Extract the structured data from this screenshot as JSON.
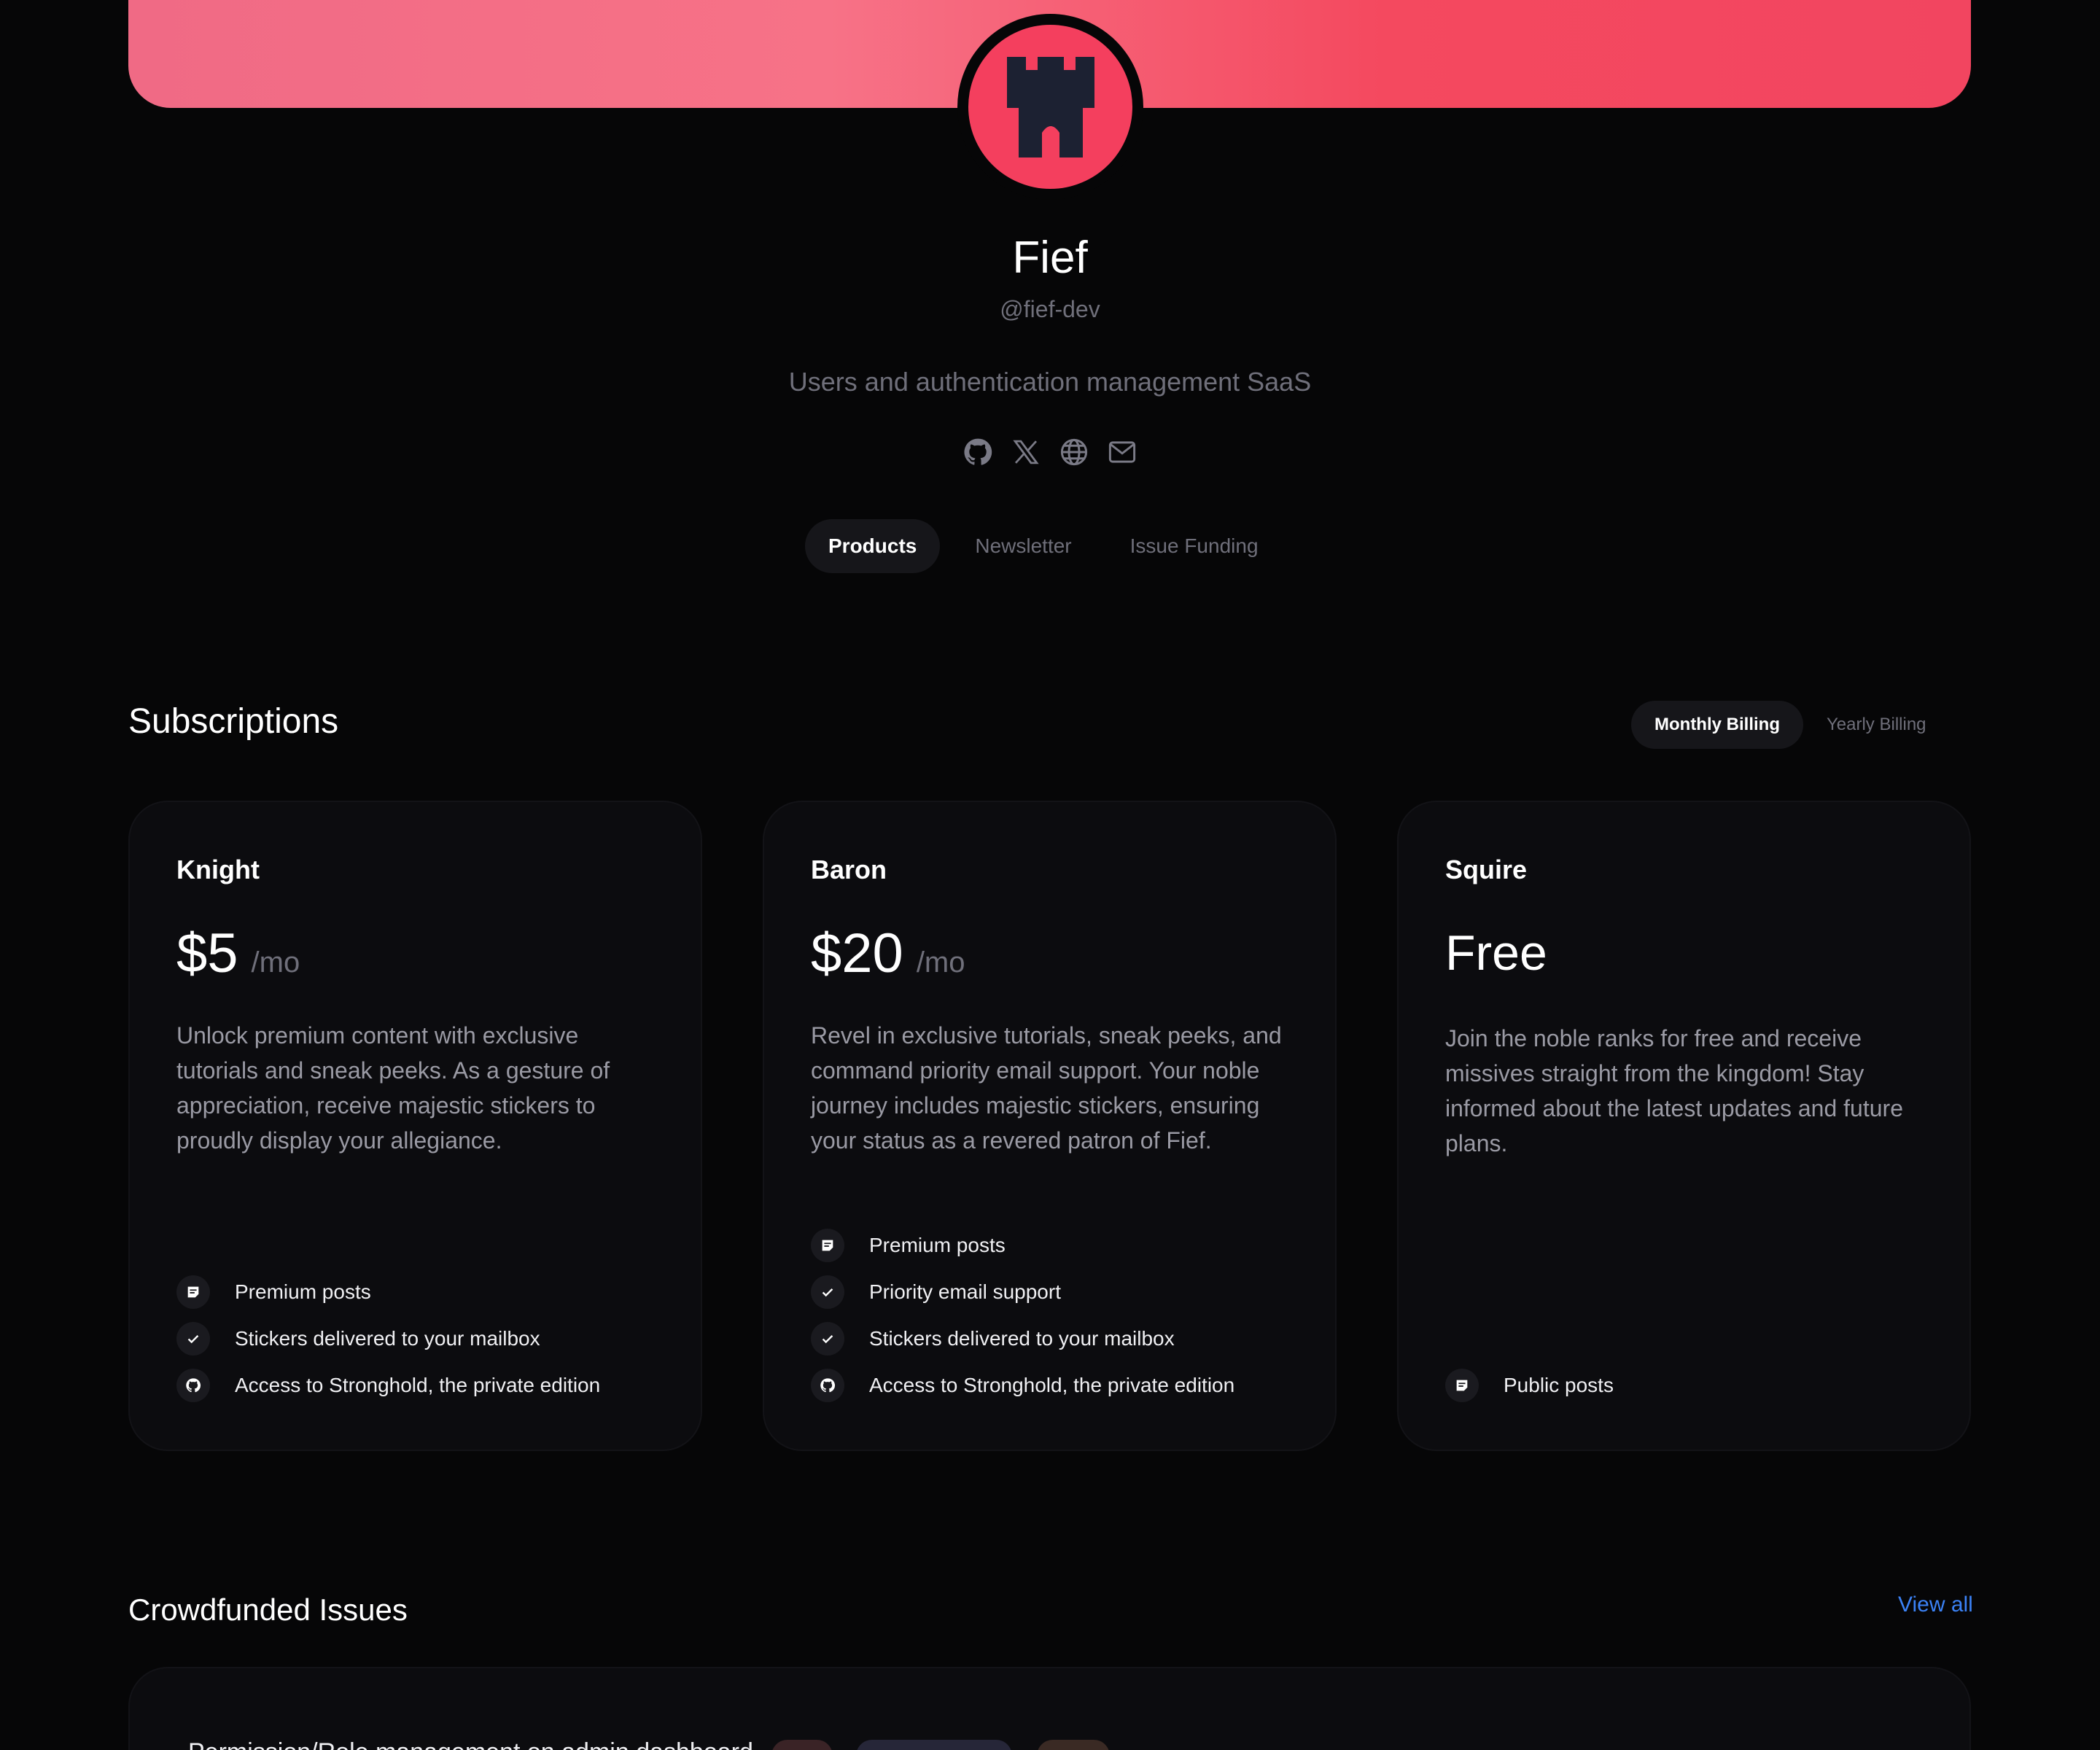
{
  "org": {
    "name": "Fief",
    "handle": "@fief-dev",
    "description": "Users and authentication management SaaS",
    "brand_color": "#f43f5e",
    "avatar_icon": "castle-icon",
    "social_icons": [
      "github-icon",
      "x-icon",
      "globe-icon",
      "mail-icon"
    ]
  },
  "tabs": [
    {
      "label": "Products",
      "active": true
    },
    {
      "label": "Newsletter",
      "active": false
    },
    {
      "label": "Issue Funding",
      "active": false
    }
  ],
  "subscriptions": {
    "title": "Subscriptions",
    "billing_options": [
      {
        "label": "Monthly Billing",
        "active": true
      },
      {
        "label": "Yearly Billing",
        "active": false
      }
    ],
    "tiers": [
      {
        "name": "Knight",
        "price": "$5",
        "period": "/mo",
        "description": "Unlock premium content with exclusive tutorials and sneak peeks. As a gesture of appreciation, receive majestic stickers to proudly display your allegiance.",
        "features": [
          {
            "icon": "post-icon",
            "label": "Premium posts"
          },
          {
            "icon": "check-icon",
            "label": "Stickers delivered to your mailbox"
          },
          {
            "icon": "github-icon",
            "label": "Access to Stronghold, the private edition"
          }
        ]
      },
      {
        "name": "Baron",
        "price": "$20",
        "period": "/mo",
        "description": "Revel in exclusive tutorials, sneak peeks, and command priority email support. Your noble journey includes majestic stickers, ensuring your status as a revered patron of Fief.",
        "features": [
          {
            "icon": "post-icon",
            "label": "Premium posts"
          },
          {
            "icon": "check-icon",
            "label": "Priority email support"
          },
          {
            "icon": "check-icon",
            "label": "Stickers delivered to your mailbox"
          },
          {
            "icon": "github-icon",
            "label": "Access to Stronghold, the private edition"
          }
        ]
      },
      {
        "name": "Squire",
        "price": "Free",
        "period": "",
        "description": "Join the noble ranks for free and receive missives straight from the kingdom! Stay informed about the latest updates and future plans.",
        "features": [
          {
            "icon": "post-icon",
            "label": "Public posts"
          }
        ]
      }
    ]
  },
  "crowdfunded": {
    "title": "Crowdfunded Issues",
    "view_all_label": "View all",
    "first_issue_title": "Permission/Role management on admin dashboard",
    "tag_colors": [
      "#3a2326",
      "#262638",
      "#3a2a24"
    ]
  }
}
